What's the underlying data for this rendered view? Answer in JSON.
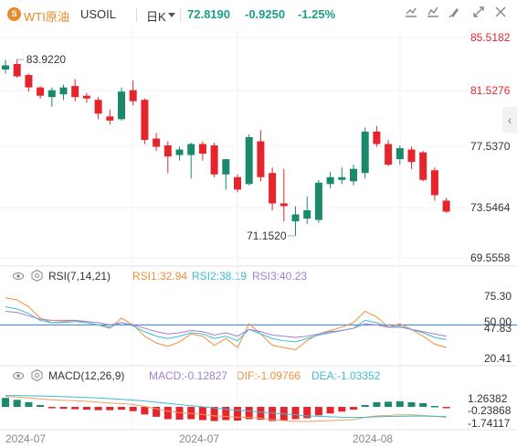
{
  "header": {
    "logo_icon": "crude-oil-icon",
    "name": "WTI原油",
    "code": "USOIL",
    "period": "日K",
    "period_dropdown_icon": "chevron-down-icon",
    "price": "72.8190",
    "change": "-0.9250",
    "change_pct": "-1.25%",
    "buttons": [
      "draw-tool-icon",
      "indicator-icon",
      "settings-icon",
      "fullscreen-icon",
      "screenshot-icon"
    ],
    "down_color": "#1b9e83"
  },
  "side_toggle_icon": "chevron-left-icon",
  "colors": {
    "up": "#e5242b",
    "down": "#1b8a6b",
    "rsi1": "#f0903c",
    "rsi2": "#3cbdd0",
    "rsi3": "#a07fd6",
    "macd_line": "#f0a060",
    "dif_line": "#3cbdd0",
    "level_line": "#3a7dd8"
  },
  "rsi_panel": {
    "name": "RSI(7,14,21)",
    "rsi1_label": "RSI1:32.94",
    "rsi2_label": "RSI2:38.19",
    "rsi3_label": "RSI3:40.23"
  },
  "macd_panel": {
    "name": "MACD(12,26,9)",
    "macd_label": "MACD:-0.12827",
    "dif_label": "DIF:-1.09766",
    "dea_label": "DEA:-1.03352"
  },
  "chart_data": {
    "type": "candlestick",
    "price_axis": {
      "ticks": [
        "85.5182",
        "81.5276",
        "77.5370",
        "73.5464",
        "69.5558"
      ],
      "range": [
        69.5558,
        85.5182
      ]
    },
    "high_label": "83.9220",
    "low_label": "71.1520",
    "x_labels": [
      "2024-07",
      "2024-07",
      "2024-08"
    ],
    "candles": [
      {
        "o": 83.2,
        "h": 83.9,
        "l": 82.9,
        "c": 83.5
      },
      {
        "o": 83.6,
        "h": 83.92,
        "l": 82.6,
        "c": 82.7
      },
      {
        "o": 82.8,
        "h": 82.9,
        "l": 81.6,
        "c": 81.9
      },
      {
        "o": 81.9,
        "h": 82.0,
        "l": 81.1,
        "c": 81.3
      },
      {
        "o": 81.2,
        "h": 81.9,
        "l": 80.5,
        "c": 81.7
      },
      {
        "o": 81.4,
        "h": 82.1,
        "l": 81.0,
        "c": 81.9
      },
      {
        "o": 82.0,
        "h": 82.5,
        "l": 80.9,
        "c": 81.2
      },
      {
        "o": 81.3,
        "h": 81.5,
        "l": 80.8,
        "c": 81.1
      },
      {
        "o": 81.0,
        "h": 81.2,
        "l": 79.6,
        "c": 80.0
      },
      {
        "o": 79.8,
        "h": 80.3,
        "l": 79.2,
        "c": 79.5
      },
      {
        "o": 79.6,
        "h": 81.9,
        "l": 79.5,
        "c": 81.6
      },
      {
        "o": 81.7,
        "h": 82.4,
        "l": 80.6,
        "c": 80.9
      },
      {
        "o": 81.0,
        "h": 81.1,
        "l": 77.8,
        "c": 78.1
      },
      {
        "o": 78.2,
        "h": 78.6,
        "l": 77.3,
        "c": 77.6
      },
      {
        "o": 77.7,
        "h": 78.0,
        "l": 75.7,
        "c": 76.9
      },
      {
        "o": 77.0,
        "h": 77.6,
        "l": 76.6,
        "c": 77.4
      },
      {
        "o": 77.0,
        "h": 77.9,
        "l": 75.3,
        "c": 77.8
      },
      {
        "o": 77.8,
        "h": 78.0,
        "l": 76.6,
        "c": 77.1
      },
      {
        "o": 77.7,
        "h": 77.9,
        "l": 75.4,
        "c": 75.6
      },
      {
        "o": 75.6,
        "h": 76.7,
        "l": 74.5,
        "c": 76.7
      },
      {
        "o": 75.4,
        "h": 75.6,
        "l": 74.3,
        "c": 74.5
      },
      {
        "o": 74.9,
        "h": 78.5,
        "l": 74.8,
        "c": 78.3
      },
      {
        "o": 78.0,
        "h": 78.8,
        "l": 75.1,
        "c": 75.4
      },
      {
        "o": 75.7,
        "h": 76.1,
        "l": 73.0,
        "c": 73.5
      },
      {
        "o": 73.5,
        "h": 76.0,
        "l": 72.2,
        "c": 73.3
      },
      {
        "o": 72.2,
        "h": 73.3,
        "l": 71.152,
        "c": 72.7
      },
      {
        "o": 72.4,
        "h": 74.0,
        "l": 72.0,
        "c": 73.0
      },
      {
        "o": 72.3,
        "h": 75.2,
        "l": 72.1,
        "c": 75.0
      },
      {
        "o": 74.9,
        "h": 75.8,
        "l": 74.6,
        "c": 75.4
      },
      {
        "o": 75.2,
        "h": 76.1,
        "l": 74.9,
        "c": 75.4
      },
      {
        "o": 75.1,
        "h": 76.3,
        "l": 74.8,
        "c": 76.0
      },
      {
        "o": 75.7,
        "h": 79.0,
        "l": 75.3,
        "c": 78.7
      },
      {
        "o": 78.7,
        "h": 79.1,
        "l": 77.6,
        "c": 77.8
      },
      {
        "o": 77.8,
        "h": 78.1,
        "l": 76.2,
        "c": 76.3
      },
      {
        "o": 76.7,
        "h": 77.7,
        "l": 76.3,
        "c": 77.5
      },
      {
        "o": 77.4,
        "h": 77.6,
        "l": 76.0,
        "c": 76.5
      },
      {
        "o": 77.2,
        "h": 77.3,
        "l": 75.1,
        "c": 75.2
      },
      {
        "o": 75.9,
        "h": 76.1,
        "l": 73.7,
        "c": 74.1
      },
      {
        "o": 73.7,
        "h": 73.9,
        "l": 72.8,
        "c": 72.9
      }
    ],
    "rsi_axis": {
      "ticks": [
        "75.30",
        "50.00",
        "47.83",
        "20.41"
      ],
      "range": [
        20.41,
        75.3
      ]
    },
    "rsi_level": 50.0,
    "rsi_series": [
      {
        "values": [
          74,
          72,
          66,
          56,
          52,
          53,
          54,
          52,
          50,
          47,
          56,
          50,
          40,
          34,
          31,
          35,
          42,
          40,
          32,
          38,
          30,
          51,
          42,
          32,
          30,
          28,
          36,
          42,
          45,
          48,
          52,
          62,
          57,
          48,
          51,
          46,
          40,
          33,
          30
        ]
      },
      {
        "values": [
          66,
          64,
          60,
          54,
          52,
          52,
          53,
          52,
          50,
          48,
          52,
          49,
          44,
          40,
          38,
          40,
          43,
          42,
          38,
          40,
          36,
          46,
          42,
          38,
          36,
          35,
          38,
          41,
          43,
          45,
          47,
          54,
          52,
          48,
          49,
          46,
          43,
          39,
          37
        ]
      },
      {
        "values": [
          62,
          61,
          58,
          55,
          54,
          54,
          54,
          53,
          52,
          50,
          52,
          50,
          47,
          44,
          42,
          43,
          45,
          44,
          41,
          43,
          40,
          46,
          44,
          41,
          40,
          39,
          40,
          42,
          44,
          45,
          47,
          51,
          50,
          48,
          48,
          46,
          44,
          42,
          40
        ]
      }
    ],
    "macd_axis": {
      "ticks": [
        "1.26382",
        "-0.23868",
        "-1.74117"
      ],
      "range": [
        -1.74117,
        1.26382
      ]
    },
    "macd_hist": [
      0.95,
      0.75,
      0.5,
      0.2,
      -0.1,
      -0.2,
      -0.25,
      -0.3,
      -0.35,
      -0.35,
      -0.3,
      -0.45,
      -0.8,
      -1.05,
      -1.3,
      -1.35,
      -1.3,
      -1.4,
      -1.5,
      -1.4,
      -1.45,
      -1.3,
      -1.35,
      -1.5,
      -1.45,
      -1.3,
      -1.2,
      -0.9,
      -0.7,
      -0.5,
      -0.3,
      0.2,
      0.5,
      0.55,
      0.6,
      0.5,
      0.4,
      0.1,
      -0.13
    ],
    "dif_series": [
      1.1,
      1.05,
      0.95,
      0.85,
      0.75,
      0.7,
      0.65,
      0.6,
      0.5,
      0.4,
      0.35,
      0.25,
      0.05,
      -0.2,
      -0.45,
      -0.6,
      -0.7,
      -0.8,
      -0.95,
      -1.0,
      -1.1,
      -1.1,
      -1.2,
      -1.35,
      -1.45,
      -1.55,
      -1.55,
      -1.5,
      -1.45,
      -1.4,
      -1.35,
      -1.1,
      -0.95,
      -0.9,
      -0.85,
      -0.85,
      -0.9,
      -1.0,
      -1.1
    ],
    "dea_series": [
      1.2,
      1.2,
      1.18,
      1.15,
      1.12,
      1.08,
      1.04,
      1.0,
      0.95,
      0.88,
      0.8,
      0.72,
      0.62,
      0.5,
      0.38,
      0.25,
      0.12,
      0.0,
      -0.12,
      -0.25,
      -0.35,
      -0.45,
      -0.55,
      -0.65,
      -0.75,
      -0.85,
      -0.95,
      -1.0,
      -1.05,
      -1.1,
      -1.12,
      -1.1,
      -1.05,
      -1.02,
      -1.0,
      -0.98,
      -0.98,
      -1.0,
      -1.03
    ]
  }
}
